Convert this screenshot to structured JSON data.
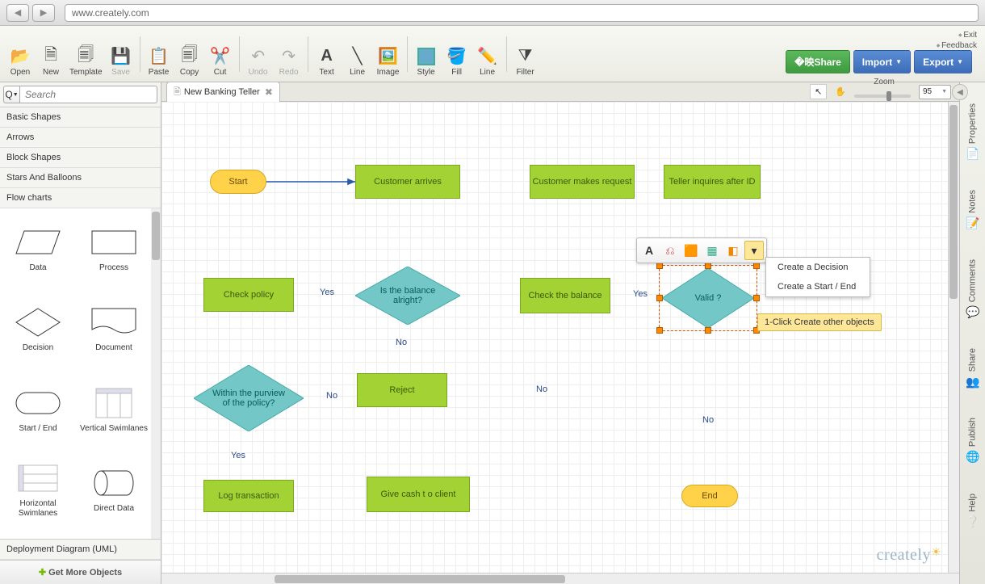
{
  "browser": {
    "url": "www.creately.com"
  },
  "toolbar": {
    "open": "Open",
    "new": "New",
    "template": "Template",
    "save": "Save",
    "paste": "Paste",
    "copy": "Copy",
    "cut": "Cut",
    "undo": "Undo",
    "redo": "Redo",
    "text": "Text",
    "line": "Line",
    "image": "Image",
    "style": "Style",
    "fill": "Fill",
    "line2": "Line",
    "filter": "Filter"
  },
  "actions": {
    "share": "Share",
    "import": "Import",
    "export": "Export"
  },
  "links": {
    "exit": "Exit",
    "feedback": "Feedback"
  },
  "sidebar": {
    "search_placeholder": "Search",
    "categories": [
      "Basic Shapes",
      "Arrows",
      "Block Shapes",
      "Stars And Balloons",
      "Flow charts"
    ],
    "shapes": [
      {
        "label": "Data"
      },
      {
        "label": "Process"
      },
      {
        "label": "Decision"
      },
      {
        "label": "Document"
      },
      {
        "label": "Start / End"
      },
      {
        "label": "Vertical Swimlanes"
      },
      {
        "label": "Horizontal Swimlanes"
      },
      {
        "label": "Direct Data"
      }
    ],
    "bottom_category": "Deployment Diagram (UML)",
    "get_more": "Get More Objects"
  },
  "tab": {
    "title": "New Banking Teller"
  },
  "zoom": {
    "label": "Zoom",
    "value": "95"
  },
  "diagram": {
    "nodes": {
      "start": "Start",
      "customer_arrives": "Customer arrives",
      "makes_request": "Customer makes request",
      "inquires_id": "Teller inquires after ID",
      "valid": "Valid  ?",
      "check_balance": "Check the balance",
      "balance_ok": "Is the balance  alright?",
      "check_policy": "Check policy",
      "within_policy": "Within the purview  of the policy?",
      "reject": "Reject",
      "log_txn": "Log transaction",
      "give_cash": "Give cash t o client",
      "end": "End"
    },
    "edge_labels": {
      "yes": "Yes",
      "no": "No"
    }
  },
  "mini_menu": {
    "item1": "Create a Decision",
    "item2": "Create a Start / End"
  },
  "tooltip": "1-Click Create other objects",
  "rightrail": [
    "Properties",
    "Notes",
    "Comments",
    "Share",
    "Publish",
    "Help"
  ],
  "logo": "creately"
}
